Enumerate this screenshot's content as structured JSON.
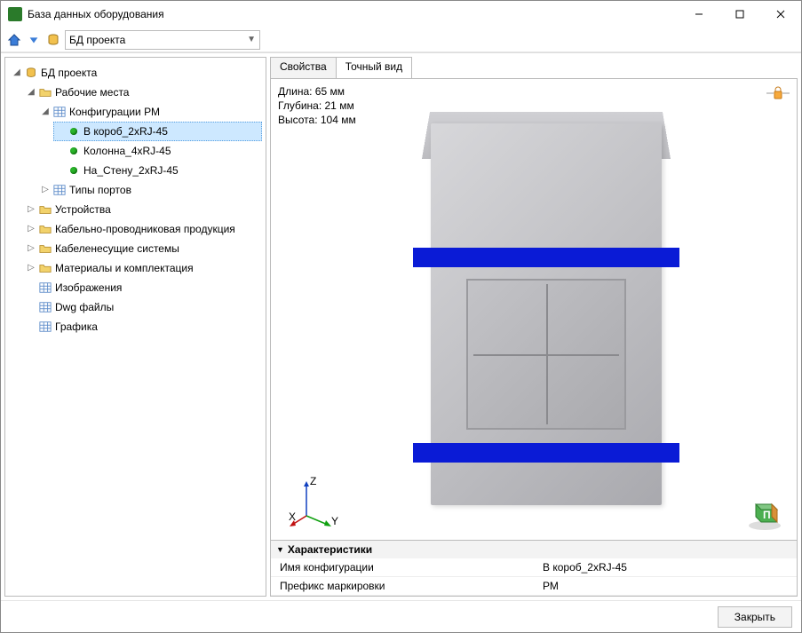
{
  "window": {
    "title": "База данных оборудования"
  },
  "toolbar": {
    "combo_value": "БД проекта"
  },
  "tree": {
    "root": "БД проекта",
    "workplaces": "Рабочие места",
    "configs": "Конфигурации РМ",
    "items": {
      "korob": "В короб_2xRJ-45",
      "kolonna": "Колонна_4xRJ-45",
      "stena": "На_Стену_2xRJ-45"
    },
    "port_types": "Типы портов",
    "devices": "Устройства",
    "cable_prod": "Кабельно-проводниковая продукция",
    "cable_sys": "Кабеленесущие системы",
    "materials": "Материалы и комплектация",
    "images": "Изображения",
    "dwg": "Dwg файлы",
    "graphics": "Графика"
  },
  "tabs": {
    "props": "Свойства",
    "view": "Точный вид"
  },
  "dimensions": {
    "length": "Длина: 65 мм",
    "depth": "Глубина: 21 мм",
    "height": "Высота: 104 мм"
  },
  "axes": {
    "x": "X",
    "y": "Y",
    "z": "Z"
  },
  "cube_label": "П",
  "props": {
    "header": "Характеристики",
    "name_label": "Имя конфигурации",
    "name_value": "В короб_2xRJ-45",
    "prefix_label": "Префикс маркировки",
    "prefix_value": "РМ"
  },
  "footer": {
    "close": "Закрыть"
  }
}
